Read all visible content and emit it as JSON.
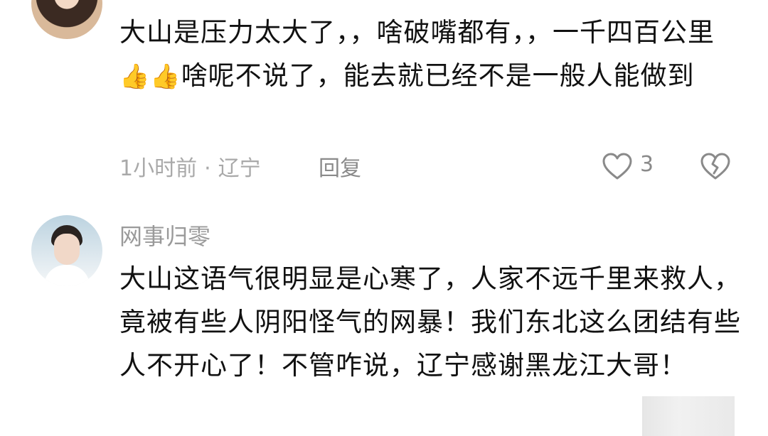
{
  "comments": [
    {
      "text_before_thumbs": "大山是压力太大了，，啥破嘴都有，，一千四百公里",
      "thumb_emoji": "👍",
      "text_after_thumbs": "啥呢不说了，能去就已经不是一般人能做到",
      "time": "1小时前",
      "separator": "·",
      "location": "辽宁",
      "reply_label": "回复",
      "like_count": "3"
    },
    {
      "username": "网事归零",
      "text": "大山这语气很明显是心寒了，人家不远千里来救人，竟被有些人阴阳怪气的网暴！我们东北这么团结有些人不开心了！不管咋说，辽宁感谢黑龙江大哥！"
    }
  ],
  "icons": {
    "like": "heart-outline-icon",
    "dislike": "broken-heart-icon",
    "thumb": "thumbs-up-emoji"
  },
  "colors": {
    "text": "#111111",
    "meta": "#a9a9a9",
    "icon": "#8a8a8a"
  }
}
